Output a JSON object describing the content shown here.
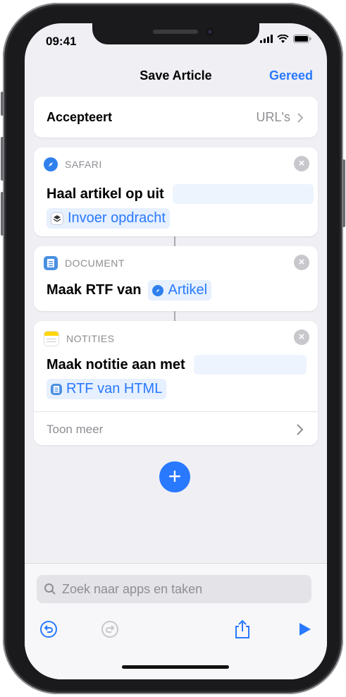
{
  "status": {
    "time": "09:41"
  },
  "nav": {
    "title": "Save Article",
    "done_label": "Gereed"
  },
  "accepts": {
    "label": "Accepteert",
    "value": "URL's"
  },
  "actions": [
    {
      "app": "SAFARI",
      "text": "Haal artikel op uit",
      "variable": "Invoer opdracht"
    },
    {
      "app": "DOCUMENT",
      "text": "Maak RTF van",
      "variable": "Artikel"
    },
    {
      "app": "NOTITIES",
      "text": "Maak notitie aan met",
      "variable": "RTF van HTML",
      "more_label": "Toon meer"
    }
  ],
  "search": {
    "placeholder": "Zoek naar apps en taken"
  },
  "colors": {
    "accent": "#2979ff",
    "background": "#efeff4"
  }
}
